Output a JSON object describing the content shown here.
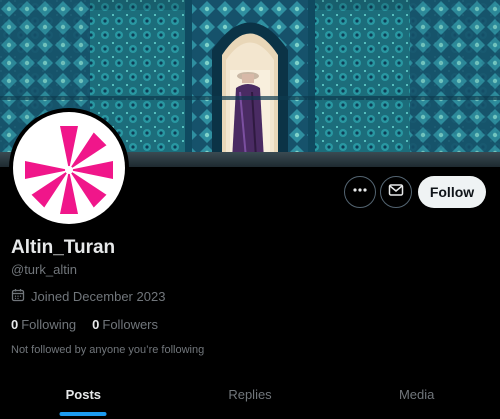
{
  "profile": {
    "display_name": "Altin_Turan",
    "handle": "@turk_altin",
    "joined": "Joined December 2023",
    "following_count": "0",
    "following_label": "Following",
    "followers_count": "0",
    "followers_label": "Followers",
    "not_followed_note": "Not followed by anyone you’re following"
  },
  "actions": {
    "more_icon": "more-horizontal-icon",
    "message_icon": "envelope-icon",
    "follow_label": "Follow"
  },
  "tabs": [
    {
      "label": "Posts",
      "active": true
    },
    {
      "label": "Replies",
      "active": false
    },
    {
      "label": "Media",
      "active": false
    }
  ],
  "colors": {
    "background": "#000000",
    "accent_blue": "#1d9bf0",
    "avatar_pink": "#f0168a",
    "text_secondary": "#71767b",
    "follow_button_bg": "#eff3f4"
  }
}
